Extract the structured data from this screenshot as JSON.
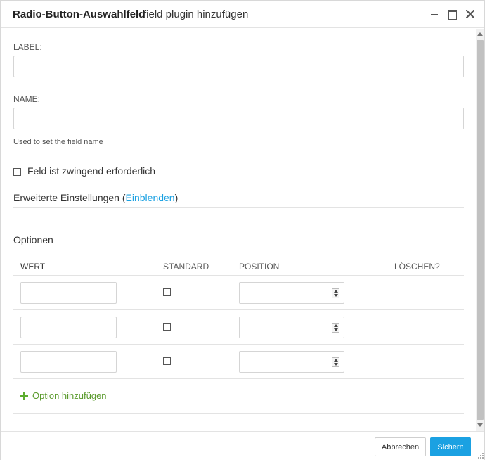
{
  "window": {
    "title": "Radio-Button-Auswahlfeld",
    "subtitle": "field plugin hinzufügen"
  },
  "form": {
    "label_field": {
      "label": "LABEL:",
      "value": ""
    },
    "name_field": {
      "label": "NAME:",
      "value": "",
      "hint": "Used to set the field name"
    },
    "required": {
      "label": "Feld ist zwingend erforderlich",
      "checked": false
    },
    "advanced": {
      "prefix": "Erweiterte Einstellungen (",
      "link": "Einblenden",
      "suffix": ")"
    }
  },
  "options": {
    "title": "Optionen",
    "columns": [
      "WERT",
      "STANDARD",
      "POSITION",
      "LÖSCHEN?"
    ],
    "rows": [
      {
        "wert": "",
        "standard": false,
        "position": ""
      },
      {
        "wert": "",
        "standard": false,
        "position": ""
      },
      {
        "wert": "",
        "standard": false,
        "position": ""
      }
    ],
    "add_label": "Option hinzufügen"
  },
  "footer": {
    "cancel_label": "Abbrechen",
    "save_label": "Sichern"
  },
  "colors": {
    "accent": "#1ba1e2",
    "add_green": "#5cad2e"
  }
}
